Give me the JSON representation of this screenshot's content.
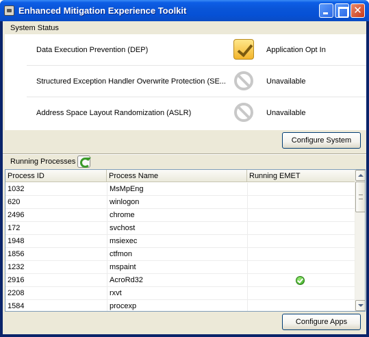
{
  "window": {
    "title": "Enhanced Mitigation Experience Toolkit",
    "icons": {
      "app": "app-window-icon",
      "minimize": "minimize-icon",
      "maximize": "maximize-icon",
      "close": "close-icon"
    },
    "close_glyph": "✕"
  },
  "system_status": {
    "label": "System Status",
    "rows": [
      {
        "name": "Data Execution Prevention (DEP)",
        "icon": "checkmark-icon",
        "state": "Application Opt In"
      },
      {
        "name": "Structured Exception Handler Overwrite Protection (SE...",
        "icon": "unavailable-icon",
        "state": "Unavailable"
      },
      {
        "name": "Address Space Layout Randomization (ASLR)",
        "icon": "unavailable-icon",
        "state": "Unavailable"
      }
    ],
    "configure_button": "Configure System"
  },
  "processes": {
    "label": "Running Processes",
    "refresh_icon": "refresh-icon",
    "columns": [
      "Process ID",
      "Process Name",
      "Running EMET"
    ],
    "rows": [
      {
        "id": "1032",
        "name": "MsMpEng",
        "emet": false
      },
      {
        "id": "620",
        "name": "winlogon",
        "emet": false
      },
      {
        "id": "2496",
        "name": "chrome",
        "emet": false
      },
      {
        "id": "172",
        "name": "svchost",
        "emet": false
      },
      {
        "id": "1948",
        "name": "msiexec",
        "emet": false
      },
      {
        "id": "1856",
        "name": "ctfmon",
        "emet": false
      },
      {
        "id": "1232",
        "name": "mspaint",
        "emet": false
      },
      {
        "id": "2916",
        "name": "AcroRd32",
        "emet": true
      },
      {
        "id": "2208",
        "name": "rxvt",
        "emet": false
      },
      {
        "id": "1584",
        "name": "procexp",
        "emet": false
      }
    ],
    "configure_button": "Configure Apps"
  },
  "colors": {
    "titlebar": "#0a55d8",
    "window_face": "#ece9d8",
    "emet_ok": "#2fa01a",
    "checkbox_gold": "#f3b52c"
  }
}
